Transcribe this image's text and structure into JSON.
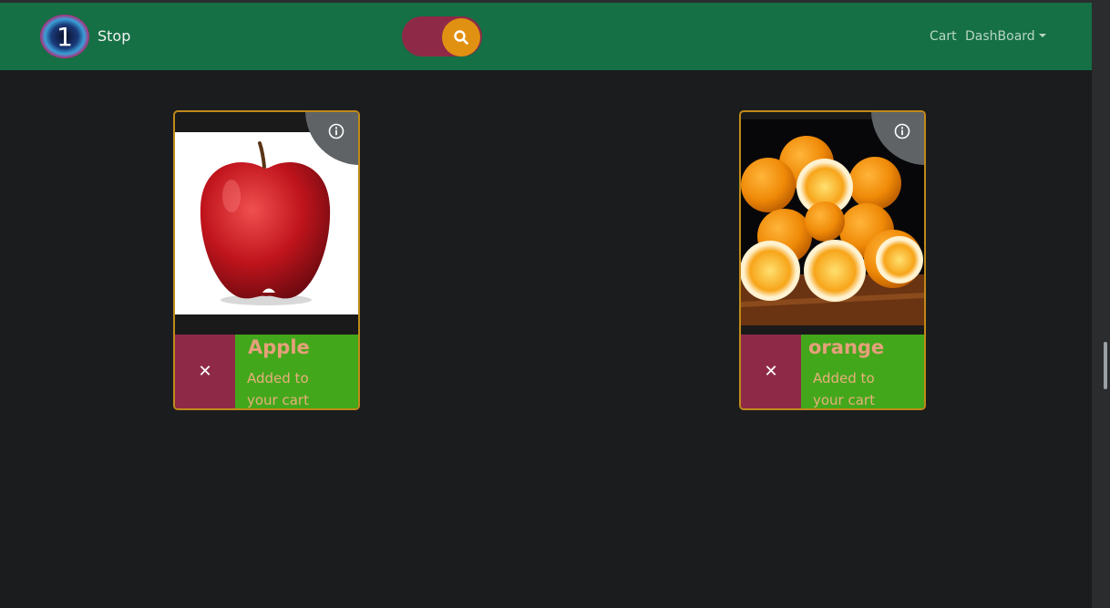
{
  "navbar": {
    "brand": "Stop",
    "logo_text": "1",
    "search_icon": "search-icon",
    "links": {
      "cart": "Cart",
      "dashboard": "DashBoard"
    },
    "colors": {
      "navbar": "#157045",
      "search_pill": "#8e2a47",
      "search_button": "#e19112"
    }
  },
  "products": [
    {
      "name": "Apple",
      "message": "Added to your cart",
      "dismiss": "✕",
      "info_icon": "info-icon"
    },
    {
      "name": "orange",
      "message": "Added to your cart",
      "dismiss": "✕",
      "info_icon": "info-icon"
    }
  ],
  "colors": {
    "page_bg": "#1b1c1e",
    "card_border": "#c08a1a",
    "dismiss_bg": "#8e2a47",
    "added_bg": "#43a71c",
    "product_text": "#e6a07a"
  }
}
